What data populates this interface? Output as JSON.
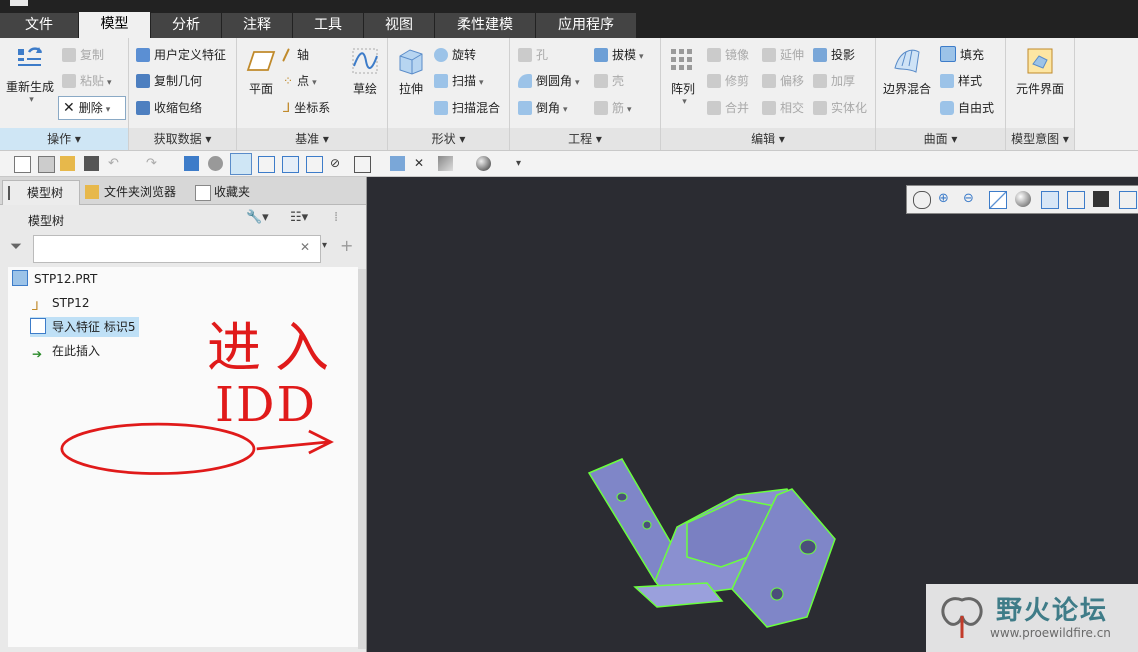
{
  "menubar": {
    "tabs": [
      {
        "label": "文件"
      },
      {
        "label": "模型"
      },
      {
        "label": "分析"
      },
      {
        "label": "注释"
      },
      {
        "label": "工具"
      },
      {
        "label": "视图"
      },
      {
        "label": "柔性建模"
      },
      {
        "label": "应用程序"
      }
    ]
  },
  "ribbon": {
    "ops": {
      "regen": "重新生成",
      "copy": "复制",
      "paste": "粘贴",
      "delete": "删除",
      "footer": "操作"
    },
    "getdata": {
      "udf": "用户定义特征",
      "copygeom": "复制几何",
      "shrink": "收缩包络",
      "footer": "获取数据"
    },
    "datum": {
      "plane": "平面",
      "axis": "轴",
      "point": "点",
      "csys": "坐标系",
      "sketch": "草绘",
      "footer": "基准"
    },
    "shape": {
      "extrude": "拉伸",
      "revolve": "旋转",
      "sweep": "扫描",
      "swept_blend": "扫描混合",
      "footer": "形状"
    },
    "eng": {
      "hole": "孔",
      "round": "倒圆角",
      "chamfer": "倒角",
      "draft": "拔模",
      "shell": "壳",
      "rib": "筋",
      "footer": "工程"
    },
    "edit": {
      "pattern": "阵列",
      "mirror": "镜像",
      "trim": "修剪",
      "merge": "合并",
      "extend": "延伸",
      "offset": "偏移",
      "intersect": "相交",
      "project": "投影",
      "thicken": "加厚",
      "solidify": "实体化",
      "footer": "编辑"
    },
    "surface": {
      "boundary": "边界混合",
      "fill": "填充",
      "style": "样式",
      "freestyle": "自由式",
      "footer": "曲面"
    },
    "intent": {
      "component_interface": "元件界面",
      "footer": "模型意图"
    }
  },
  "panel": {
    "tabs": {
      "model_tree": "模型树",
      "folder_browser": "文件夹浏览器",
      "favorites": "收藏夹"
    },
    "header": "模型树",
    "filter_value": "",
    "tree": {
      "root": "STP12.PRT",
      "items": [
        {
          "label": "STP12"
        },
        {
          "label": "导入特征 标识5"
        },
        {
          "label": "在此插入"
        }
      ]
    }
  },
  "annotation": {
    "text_line1": "进入",
    "text_line2": "IDD"
  },
  "watermark": {
    "title": "野火论坛",
    "url": "www.proewildfire.cn"
  },
  "colors": {
    "accent": "#cfe6f5",
    "highlight": "#bfe0f6",
    "annotation": "#e01a1a",
    "part_fill": "#7f86c8",
    "part_edge": "#6bff3f"
  }
}
